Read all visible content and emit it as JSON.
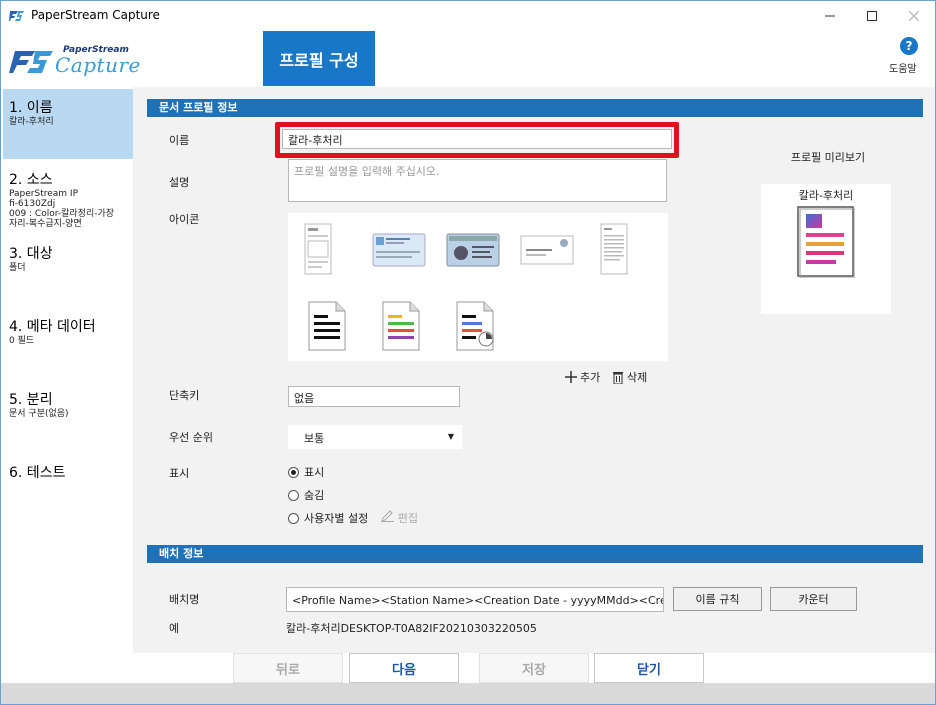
{
  "window": {
    "title": "PaperStream Capture"
  },
  "logo": {
    "line1": "PaperStream",
    "line2": "Capture"
  },
  "header": {
    "tab_label": "프로필 구성",
    "help_label": "도움말"
  },
  "sidebar": {
    "items": [
      {
        "title": "1. 이름",
        "sub": "칼라-후처리"
      },
      {
        "title": "2. 소스",
        "sub": "PaperStream IP\nfi-6130Zdj\n009 : Color-칼라정리-가장자리-복수급지-양면"
      },
      {
        "title": "3. 대상",
        "sub": "폴더"
      },
      {
        "title": "4. 메타 데이터",
        "sub": "0 필드"
      },
      {
        "title": "5. 분리",
        "sub": "문서 구분(없음)"
      },
      {
        "title": "6. 테스트",
        "sub": ""
      }
    ]
  },
  "doc_profile": {
    "section_title": "문서 프로필 정보",
    "name_label": "이름",
    "name_value": "칼라-후처리",
    "desc_label": "설명",
    "desc_placeholder": "프로필 설명을 입력해 주십시오.",
    "icon_label": "아이콘",
    "add_label": "추가",
    "delete_label": "삭제",
    "shortcut_label": "단축키",
    "shortcut_value": "없음",
    "priority_label": "우선 순위",
    "priority_value": "보통",
    "display_label": "표시",
    "display_options": [
      "표시",
      "숨김",
      "사용자별 설정"
    ],
    "display_selected": 0,
    "edit_label": "편집"
  },
  "preview": {
    "title": "프로필 미리보기",
    "name": "칼라-후처리"
  },
  "batch": {
    "section_title": "배치 정보",
    "batch_name_label": "배치명",
    "batch_name_value": "<Profile Name><Station Name><Creation Date - yyyyMMdd><Creation T",
    "naming_rule_button": "이름 규칙",
    "counter_button": "카운터",
    "example_label": "예",
    "example_value": "칼라-후처리DESKTOP-T0A82IF20210303220505"
  },
  "footer": {
    "back": "뒤로",
    "next": "다음",
    "save": "저장",
    "close": "닫기"
  },
  "colors": {
    "accent": "#1877c6",
    "section": "#1f71b8",
    "highlight": "#e0101f",
    "sidebar_active": "#b9d8f2"
  }
}
